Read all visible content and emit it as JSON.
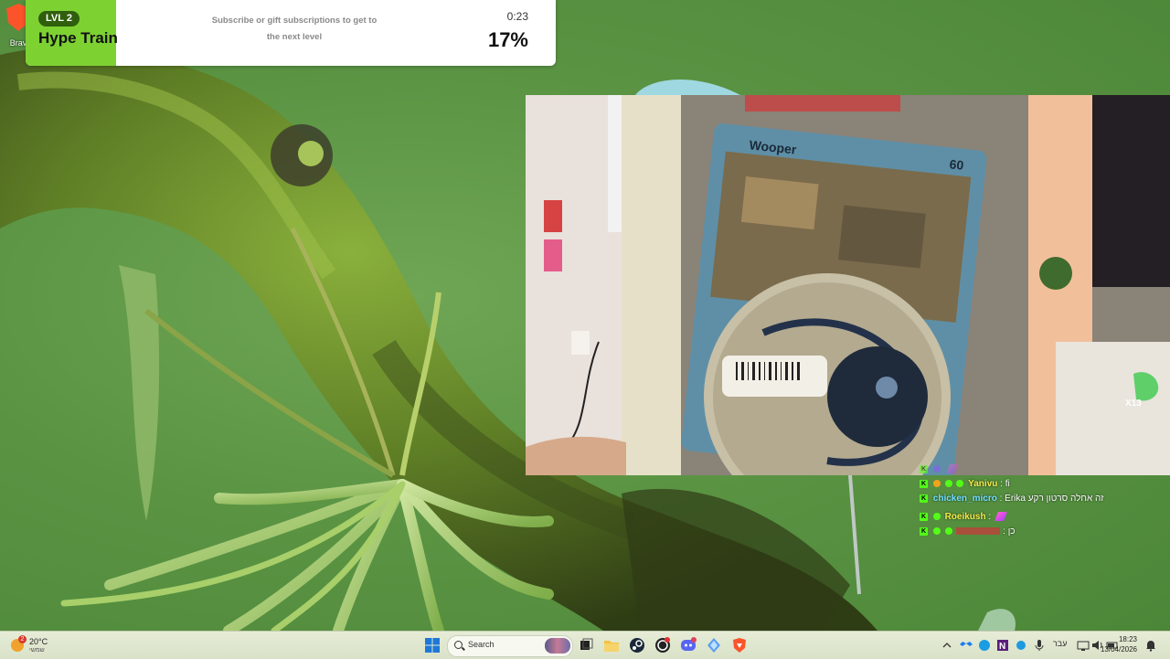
{
  "desktop": {
    "icons": [
      {
        "label": "Brav",
        "icon": "brave-icon"
      }
    ]
  },
  "hype_train": {
    "level": "LVL 2",
    "title": "Hype Train",
    "description": "Subscribe or gift subscriptions to get to the next level",
    "timer": "0:23",
    "progress_percent": "17%",
    "progress_fraction": 0.17,
    "accent_color": "#7dd232"
  },
  "webcam": {
    "card_name": "Wooper",
    "card_hp": "60"
  },
  "chat": {
    "messages": [
      {
        "user": "Yanivu",
        "text": " : fi",
        "user_color": "#f4e94a",
        "emote": false
      },
      {
        "user": "chicken_micro",
        "text": " : Erika זה אחלה סרטון רקע",
        "user_color": "#6fe0ff",
        "emote": false
      },
      {
        "user": "Roeikush",
        "text": " : ",
        "user_color": "#f4e94a",
        "emote": true
      },
      {
        "user": "",
        "text": " : כן",
        "user_color": "#e2263a",
        "emote": false
      }
    ],
    "platform_icon": "kick-icon"
  },
  "taskbar": {
    "weather": {
      "temp": "20°C",
      "condition": "שמשי",
      "alert": "2"
    },
    "search_placeholder": "Search",
    "pinned_apps": [
      "windows-start-icon",
      "search-icon",
      "media-thumbnail",
      "task-view-icon",
      "file-explorer-icon",
      "steam-icon",
      "obs-icon",
      "discord-icon",
      "app-diamond-icon",
      "brave-browser-icon"
    ],
    "tray": {
      "language": "עבר",
      "time": "18:23",
      "date": "13/04/2026"
    }
  }
}
